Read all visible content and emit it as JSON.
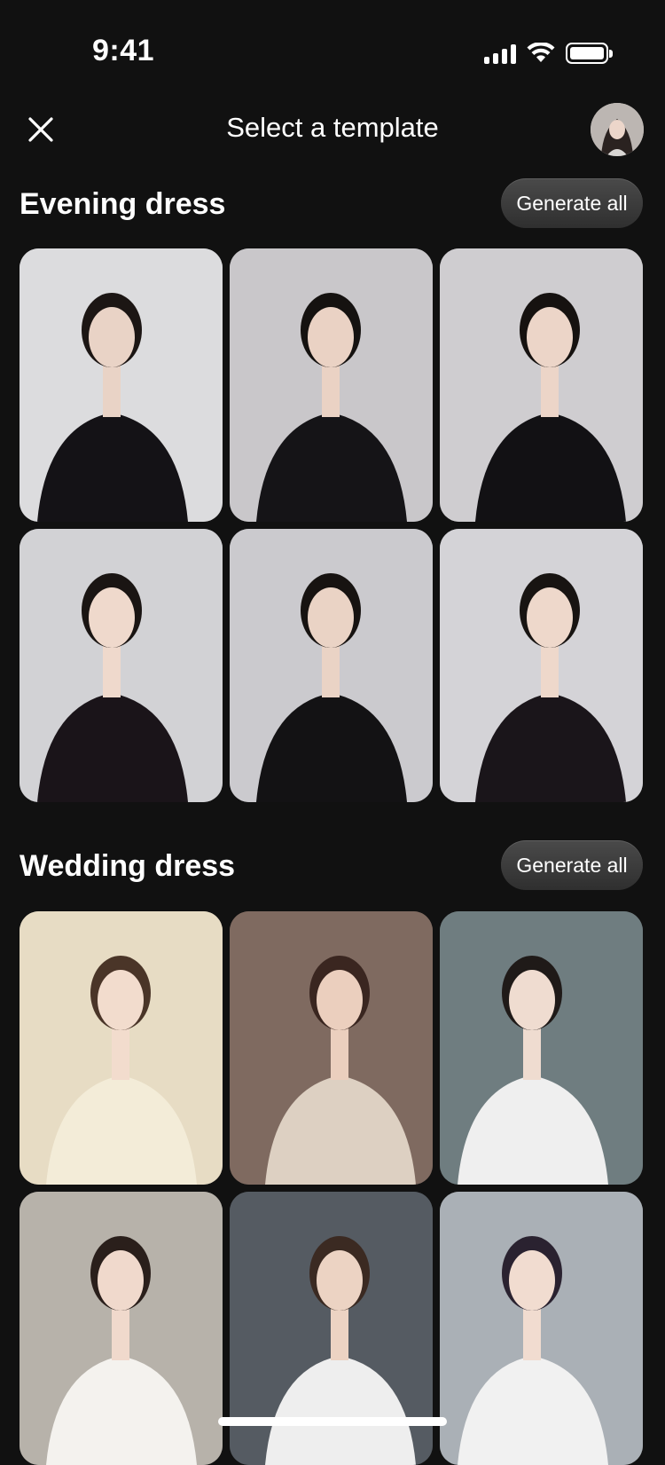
{
  "status_bar": {
    "time": "9:41",
    "icons": [
      "signal-icon",
      "wifi-icon",
      "battery-icon"
    ]
  },
  "header": {
    "title": "Select a template",
    "close_icon": "close-icon",
    "avatar": "user-avatar"
  },
  "sections": [
    {
      "title": "Evening dress",
      "button_label": "Generate all",
      "templates": [
        {
          "bg": "#dcdcde",
          "dress": "#141216",
          "hair": "#1c1614",
          "skin": "#e9d3c6"
        },
        {
          "bg": "#c9c7ca",
          "dress": "#151417",
          "hair": "#151210",
          "skin": "#ead2c4"
        },
        {
          "bg": "#cfcdd0",
          "dress": "#121114",
          "hair": "#161210",
          "skin": "#ecd5c8"
        },
        {
          "bg": "#d2d2d5",
          "dress": "#1a1419",
          "hair": "#1a1513",
          "skin": "#efd9cc"
        },
        {
          "bg": "#cbcace",
          "dress": "#131214",
          "hair": "#171311",
          "skin": "#ead3c5"
        },
        {
          "bg": "#d4d3d7",
          "dress": "#1a151a",
          "hair": "#181412",
          "skin": "#eed8cb"
        }
      ]
    },
    {
      "title": "Wedding dress",
      "button_label": "Generate all",
      "templates": [
        {
          "bg": "#e7dcc4",
          "dress": "#f3ecd8",
          "hair": "#4a3528",
          "skin": "#f2dccd"
        },
        {
          "bg": "#7f6a60",
          "dress": "#ddd0c2",
          "hair": "#3a2620",
          "skin": "#ebcfbe"
        },
        {
          "bg": "#6f7d80",
          "dress": "#efefef",
          "hair": "#1f1a18",
          "skin": "#efdcd0"
        },
        {
          "bg": "#b7b2aa",
          "dress": "#f4f2ee",
          "hair": "#2a1f1b",
          "skin": "#f0d9cc"
        },
        {
          "bg": "#555b62",
          "dress": "#eeeeee",
          "hair": "#3b2a22",
          "skin": "#ecd3c3"
        },
        {
          "bg": "#aab0b6",
          "dress": "#f1f1f1",
          "hair": "#2a2230",
          "skin": "#f1dcd0"
        }
      ]
    }
  ],
  "colors": {
    "background": "#111111",
    "button_bg": "#3c3c3c",
    "text": "#ffffff"
  }
}
